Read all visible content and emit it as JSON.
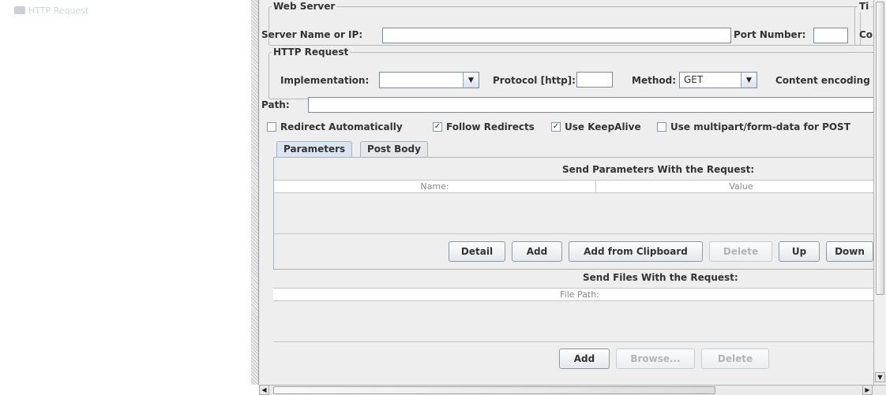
{
  "tree": {
    "item_label": "HTTP Request"
  },
  "web_server": {
    "legend": "Web Server",
    "server_label": "Server Name or IP:",
    "server_value": "",
    "port_label": "Port Number:",
    "port_value": "",
    "timeouts_legend_partial": "Ti",
    "connect_label_partial": "Co"
  },
  "http_request": {
    "legend": "HTTP Request",
    "implementation_label": "Implementation:",
    "implementation_value": "",
    "protocol_label": "Protocol [http]:",
    "protocol_value": "",
    "method_label": "Method:",
    "method_value": "GET",
    "content_encoding_label": "Content encoding",
    "path_label": "Path:",
    "path_value": ""
  },
  "options": {
    "redirect_auto": {
      "label": "Redirect Automatically",
      "checked": false
    },
    "follow_redirects": {
      "label": "Follow Redirects",
      "checked": true
    },
    "use_keepalive": {
      "label": "Use KeepAlive",
      "checked": true
    },
    "multipart": {
      "label": "Use multipart/form-data for POST",
      "checked": false
    }
  },
  "tabs": [
    {
      "label": "Parameters",
      "active": true
    },
    {
      "label": "Post Body",
      "active": false
    }
  ],
  "parameters": {
    "title": "Send Parameters With the Request:",
    "columns": [
      "Name:",
      "Value"
    ],
    "buttons": {
      "detail": "Detail",
      "add": "Add",
      "add_from_clipboard": "Add from Clipboard",
      "delete": "Delete",
      "up": "Up",
      "down": "Down"
    }
  },
  "files": {
    "title": "Send Files With the Request:",
    "columns": [
      "File Path:"
    ],
    "buttons": {
      "add": "Add",
      "browse": "Browse...",
      "delete": "Delete"
    }
  },
  "icons": {
    "tree_item": "http-request-icon",
    "combo_arrow": "chevron-down-icon",
    "check": "checkmark-icon",
    "scroll_left": "arrow-left-icon",
    "scroll_right": "arrow-right-icon",
    "scroll_down": "arrow-down-icon"
  },
  "colors": {
    "panel_bg": "#eeeeee",
    "active_tab": "#dbe5f0",
    "disabled_text": "#b4b4b4"
  }
}
